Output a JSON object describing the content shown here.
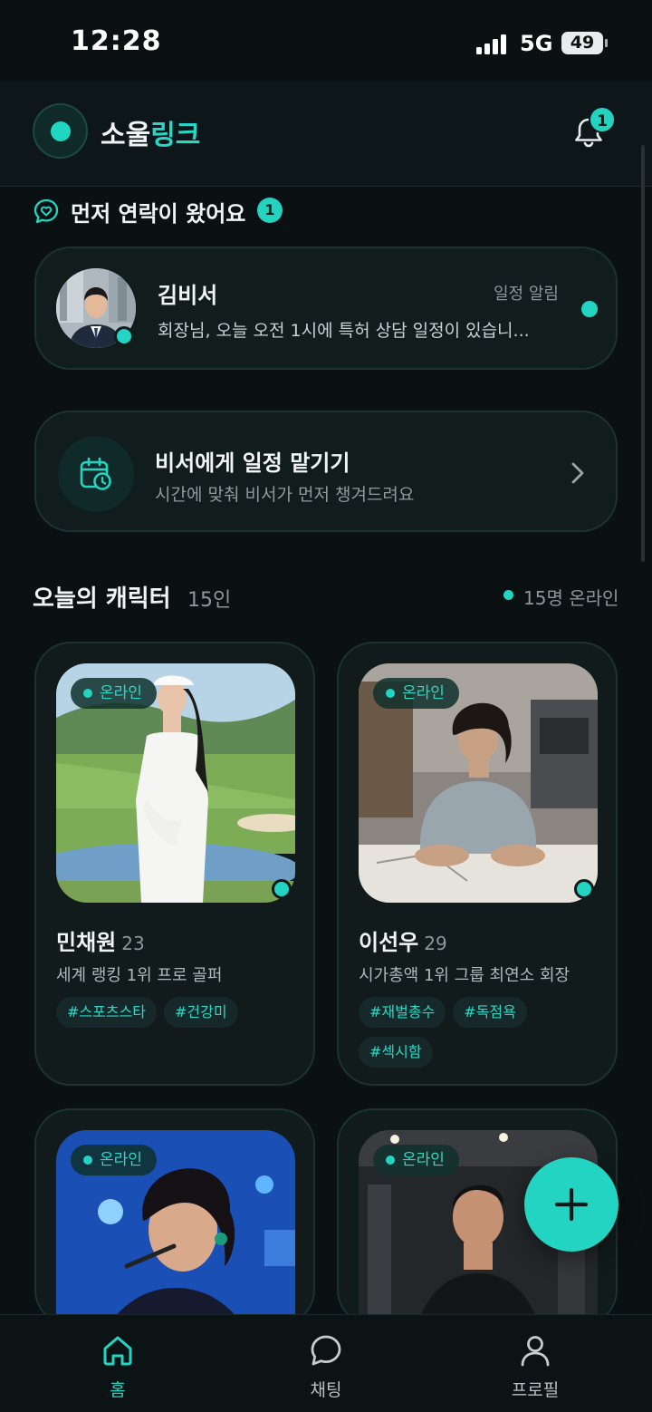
{
  "status_bar": {
    "time": "12:28",
    "network": "5G",
    "battery": "49"
  },
  "header": {
    "logo_part1": "소울",
    "logo_part2": "링크",
    "notification_count": "1"
  },
  "contact_section": {
    "title": "먼저 연락이 왔어요",
    "count": "1",
    "message": {
      "name": "김비서",
      "tag": "일정 알림",
      "preview": "회장님, 오늘 오전 1시에 특허 상담 일정이 있습니..."
    }
  },
  "schedule_card": {
    "title": "비서에게 일정 맡기기",
    "subtitle": "시간에 맞춰 비서가 먼저 챙겨드려요"
  },
  "characters_section": {
    "title": "오늘의 캐릭터",
    "count": "15인",
    "online_label": "15명 온라인",
    "cards": [
      {
        "online_label": "온라인",
        "name": "민채원",
        "age": "23",
        "desc": "세계 랭킹 1위 프로 골퍼",
        "tags": [
          "#스포츠스타",
          "#건강미"
        ]
      },
      {
        "online_label": "온라인",
        "name": "이선우",
        "age": "29",
        "desc": "시가총액 1위 그룹 최연소 회장",
        "tags": [
          "#재벌총수",
          "#독점욕",
          "#섹시함"
        ]
      },
      {
        "online_label": "온라인"
      },
      {
        "online_label": "온라인"
      }
    ]
  },
  "tabbar": {
    "tabs": [
      {
        "label": "홈",
        "icon": "home-icon",
        "active": true
      },
      {
        "label": "채팅",
        "icon": "chat-bubble-icon",
        "active": false
      },
      {
        "label": "프로필",
        "icon": "person-icon",
        "active": false
      }
    ]
  },
  "colors": {
    "accent": "#22d4c1",
    "background": "#0b1113",
    "card": "#111c1d"
  }
}
